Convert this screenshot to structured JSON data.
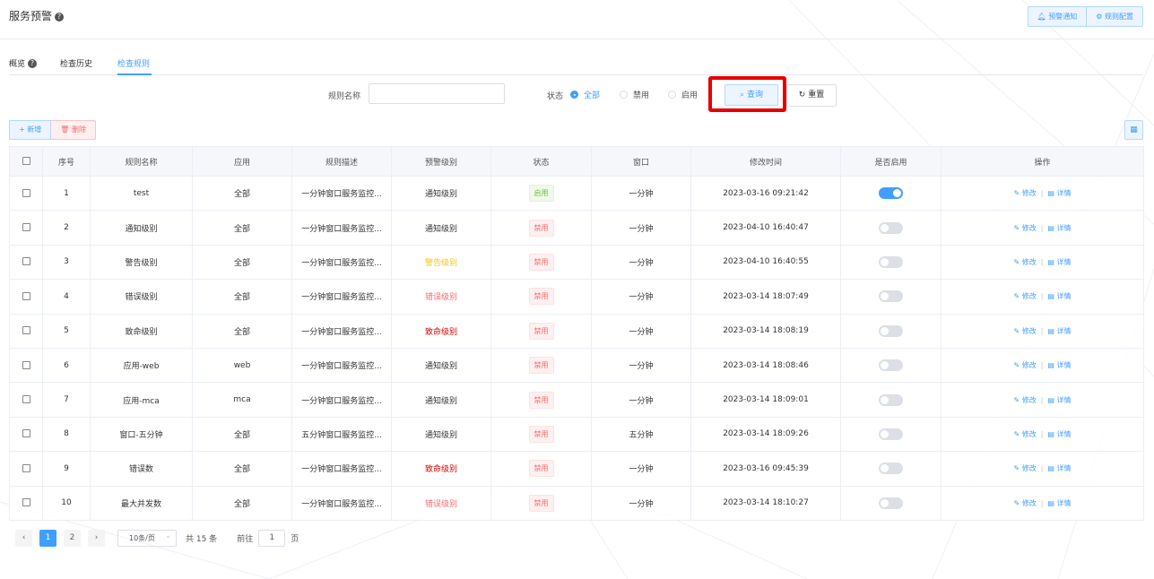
{
  "header": {
    "title": "服务预警",
    "help_icon": "?",
    "alert_notify": "预警通知",
    "rule_config": "规则配置"
  },
  "tabs": [
    {
      "label": "概览"
    },
    {
      "label": "检查历史"
    },
    {
      "label": "检查规则"
    }
  ],
  "filters": {
    "rule_name_label": "规则名称",
    "rule_name_value": "",
    "status_label": "状态",
    "status_options": [
      "全部",
      "禁用",
      "启用"
    ],
    "status_selected": "全部",
    "query": "查询",
    "reset": "重置"
  },
  "toolbar": {
    "add": "新增",
    "delete": "删除"
  },
  "table": {
    "columns": [
      "序号",
      "规则名称",
      "应用",
      "规则描述",
      "预警级别",
      "状态",
      "窗口",
      "修改时间",
      "是否启用",
      "操作"
    ],
    "edit": "修改",
    "detail": "详情",
    "rows": [
      {
        "no": "1",
        "name": "test",
        "app": "全部",
        "desc": "一分钟窗口服务监控...",
        "level": "通知级别",
        "level_color": "#333333",
        "status": "启用",
        "window": "一分钟",
        "time": "2023-03-16 09:21:42",
        "enabled": true
      },
      {
        "no": "2",
        "name": "通知级别",
        "app": "全部",
        "desc": "一分钟窗口服务监控...",
        "level": "通知级别",
        "level_color": "#333333",
        "status": "禁用",
        "window": "一分钟",
        "time": "2023-04-10 16:40:47",
        "enabled": false
      },
      {
        "no": "3",
        "name": "警告级别",
        "app": "全部",
        "desc": "一分钟窗口服务监控...",
        "level": "警告级别",
        "level_color": "#f5c518",
        "status": "禁用",
        "window": "一分钟",
        "time": "2023-04-10 16:40:55",
        "enabled": false
      },
      {
        "no": "4",
        "name": "错误级别",
        "app": "全部",
        "desc": "一分钟窗口服务监控...",
        "level": "错误级别",
        "level_color": "#f56c6c",
        "status": "禁用",
        "window": "一分钟",
        "time": "2023-03-14 18:07:49",
        "enabled": false
      },
      {
        "no": "5",
        "name": "致命级别",
        "app": "全部",
        "desc": "一分钟窗口服务监控...",
        "level": "致命级别",
        "level_color": "#d40000",
        "status": "禁用",
        "window": "一分钟",
        "time": "2023-03-14 18:08:19",
        "enabled": false
      },
      {
        "no": "6",
        "name": "应用-web",
        "app": "web",
        "desc": "一分钟窗口服务监控...",
        "level": "通知级别",
        "level_color": "#333333",
        "status": "禁用",
        "window": "一分钟",
        "time": "2023-03-14 18:08:46",
        "enabled": false
      },
      {
        "no": "7",
        "name": "应用-mca",
        "app": "mca",
        "desc": "一分钟窗口服务监控...",
        "level": "通知级别",
        "level_color": "#333333",
        "status": "禁用",
        "window": "一分钟",
        "time": "2023-03-14 18:09:01",
        "enabled": false
      },
      {
        "no": "8",
        "name": "窗口-五分钟",
        "app": "全部",
        "desc": "五分钟窗口服务监控...",
        "level": "通知级别",
        "level_color": "#333333",
        "status": "禁用",
        "window": "五分钟",
        "time": "2023-03-14 18:09:26",
        "enabled": false
      },
      {
        "no": "9",
        "name": "错误数",
        "app": "全部",
        "desc": "一分钟窗口服务监控...",
        "level": "致命级别",
        "level_color": "#d40000",
        "status": "禁用",
        "window": "一分钟",
        "time": "2023-03-16 09:45:39",
        "enabled": false
      },
      {
        "no": "10",
        "name": "最大并发数",
        "app": "全部",
        "desc": "一分钟窗口服务监控...",
        "level": "错误级别",
        "level_color": "#f56c6c",
        "status": "禁用",
        "window": "一分钟",
        "time": "2023-03-14 18:10:27",
        "enabled": false
      }
    ]
  },
  "pagination": {
    "pages": [
      "1",
      "2"
    ],
    "current": "1",
    "page_size": "10条/页",
    "total": "共 15 条",
    "goto_prefix": "前往",
    "goto_value": "1",
    "goto_suffix": "页"
  }
}
